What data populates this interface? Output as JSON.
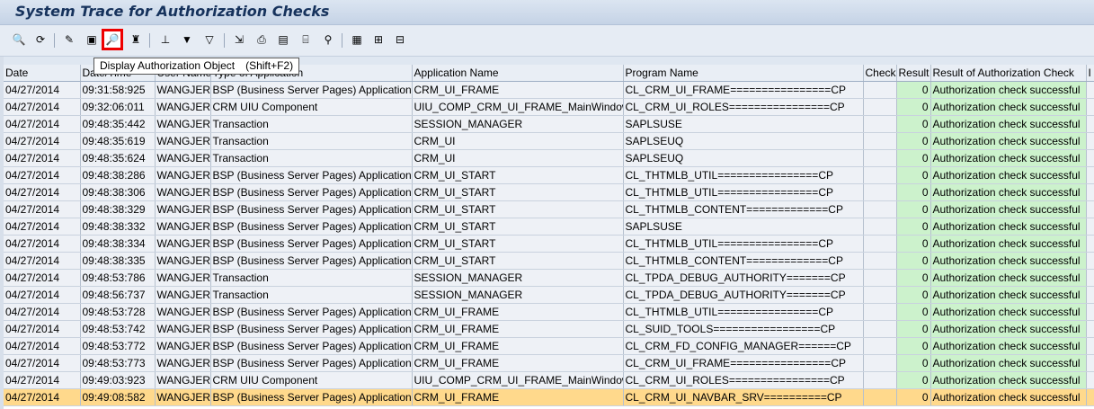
{
  "window": {
    "title": "System Trace for Authorization Checks"
  },
  "toolbar": {
    "icons": [
      "refresh-icon",
      "cycle-icon",
      "details-icon",
      "display-auth-trace-icon",
      "display-auth-object-icon",
      "auth-icon",
      "sort-ascending-icon",
      "filter-icon",
      "filter-clear-icon",
      "export-icon",
      "print-icon",
      "excel-icon",
      "print-preview-icon",
      "find-icon",
      "layout-icon",
      "layout-change-icon",
      "layout-save-icon"
    ]
  },
  "tooltip": {
    "text": "Display Authorization Object",
    "shortcut": "(Shift+F2)"
  },
  "columns": [
    "Date",
    "Date/Time",
    "User Name",
    "Type of Application",
    "Application Name",
    "Program Name",
    "Check",
    "Result",
    "Result of Authorization Check",
    "I"
  ],
  "rows": [
    [
      "04/27/2014",
      "09:31:58:925",
      "WANGJER",
      "BSP (Business Server Pages) Application",
      "CRM_UI_FRAME",
      "CL_CRM_UI_FRAME================CP",
      "",
      "0",
      "Authorization check successful"
    ],
    [
      "04/27/2014",
      "09:32:06:011",
      "WANGJER",
      "CRM UIU Component",
      "UIU_COMP_CRM_UI_FRAME_MainWindow",
      "CL_CRM_UI_ROLES================CP",
      "",
      "0",
      "Authorization check successful"
    ],
    [
      "04/27/2014",
      "09:48:35:442",
      "WANGJER",
      "Transaction",
      "SESSION_MANAGER",
      "SAPLSUSE",
      "",
      "0",
      "Authorization check successful"
    ],
    [
      "04/27/2014",
      "09:48:35:619",
      "WANGJER",
      "Transaction",
      "CRM_UI",
      "SAPLSEUQ",
      "",
      "0",
      "Authorization check successful"
    ],
    [
      "04/27/2014",
      "09:48:35:624",
      "WANGJER",
      "Transaction",
      "CRM_UI",
      "SAPLSEUQ",
      "",
      "0",
      "Authorization check successful"
    ],
    [
      "04/27/2014",
      "09:48:38:286",
      "WANGJER",
      "BSP (Business Server Pages) Application",
      "CRM_UI_START",
      "CL_THTMLB_UTIL================CP",
      "",
      "0",
      "Authorization check successful"
    ],
    [
      "04/27/2014",
      "09:48:38:306",
      "WANGJER",
      "BSP (Business Server Pages) Application",
      "CRM_UI_START",
      "CL_THTMLB_UTIL================CP",
      "",
      "0",
      "Authorization check successful"
    ],
    [
      "04/27/2014",
      "09:48:38:329",
      "WANGJER",
      "BSP (Business Server Pages) Application",
      "CRM_UI_START",
      "CL_THTMLB_CONTENT=============CP",
      "",
      "0",
      "Authorization check successful"
    ],
    [
      "04/27/2014",
      "09:48:38:332",
      "WANGJER",
      "BSP (Business Server Pages) Application",
      "CRM_UI_START",
      "SAPLSUSE",
      "",
      "0",
      "Authorization check successful"
    ],
    [
      "04/27/2014",
      "09:48:38:334",
      "WANGJER",
      "BSP (Business Server Pages) Application",
      "CRM_UI_START",
      "CL_THTMLB_UTIL================CP",
      "",
      "0",
      "Authorization check successful"
    ],
    [
      "04/27/2014",
      "09:48:38:335",
      "WANGJER",
      "BSP (Business Server Pages) Application",
      "CRM_UI_START",
      "CL_THTMLB_CONTENT=============CP",
      "",
      "0",
      "Authorization check successful"
    ],
    [
      "04/27/2014",
      "09:48:53:786",
      "WANGJER",
      "Transaction",
      "SESSION_MANAGER",
      "CL_TPDA_DEBUG_AUTHORITY=======CP",
      "",
      "0",
      "Authorization check successful"
    ],
    [
      "04/27/2014",
      "09:48:56:737",
      "WANGJER",
      "Transaction",
      "SESSION_MANAGER",
      "CL_TPDA_DEBUG_AUTHORITY=======CP",
      "",
      "0",
      "Authorization check successful"
    ],
    [
      "04/27/2014",
      "09:48:53:728",
      "WANGJER",
      "BSP (Business Server Pages) Application",
      "CRM_UI_FRAME",
      "CL_THTMLB_UTIL================CP",
      "",
      "0",
      "Authorization check successful"
    ],
    [
      "04/27/2014",
      "09:48:53:742",
      "WANGJER",
      "BSP (Business Server Pages) Application",
      "CRM_UI_FRAME",
      "CL_SUID_TOOLS=================CP",
      "",
      "0",
      "Authorization check successful"
    ],
    [
      "04/27/2014",
      "09:48:53:772",
      "WANGJER",
      "BSP (Business Server Pages) Application",
      "CRM_UI_FRAME",
      "CL_CRM_FD_CONFIG_MANAGER======CP",
      "",
      "0",
      "Authorization check successful"
    ],
    [
      "04/27/2014",
      "09:48:53:773",
      "WANGJER",
      "BSP (Business Server Pages) Application",
      "CRM_UI_FRAME",
      "CL_CRM_UI_FRAME================CP",
      "",
      "0",
      "Authorization check successful"
    ],
    [
      "04/27/2014",
      "09:49:03:923",
      "WANGJER",
      "CRM UIU Component",
      "UIU_COMP_CRM_UI_FRAME_MainWindow",
      "CL_CRM_UI_ROLES================CP",
      "",
      "0",
      "Authorization check successful"
    ],
    [
      "04/27/2014",
      "09:49:08:582",
      "WANGJER",
      "BSP (Business Server Pages) Application",
      "CRM_UI_FRAME",
      "CL_CRM_UI_NAVBAR_SRV==========CP",
      "",
      "0",
      "Authorization check successful"
    ]
  ],
  "selected_row": 18
}
